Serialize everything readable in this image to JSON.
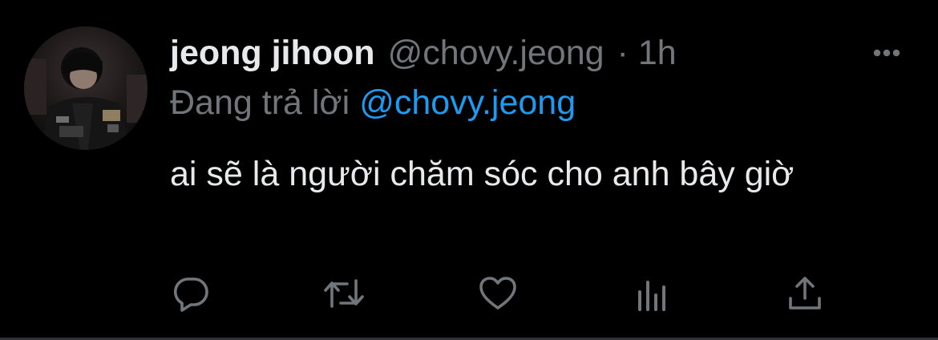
{
  "tweet": {
    "display_name": "jeong jihoon",
    "handle": "@chovy.jeong",
    "separator": "·",
    "time": "1h",
    "reply_prefix": "Đang trả lời",
    "reply_mention": "@chovy.jeong",
    "text": "ai sẽ là người chăm sóc cho anh bây giờ"
  },
  "icons": {
    "more": "more-horizontal-icon",
    "reply": "reply-bubble-icon",
    "retweet": "retweet-icon",
    "like": "heart-icon",
    "views": "views-bar-chart-icon",
    "share": "share-upload-icon"
  },
  "colors": {
    "background": "#000000",
    "primary_text": "#e7e9ea",
    "secondary_text": "#71767b",
    "mention": "#1d9bf0",
    "divider": "#2f3336"
  }
}
